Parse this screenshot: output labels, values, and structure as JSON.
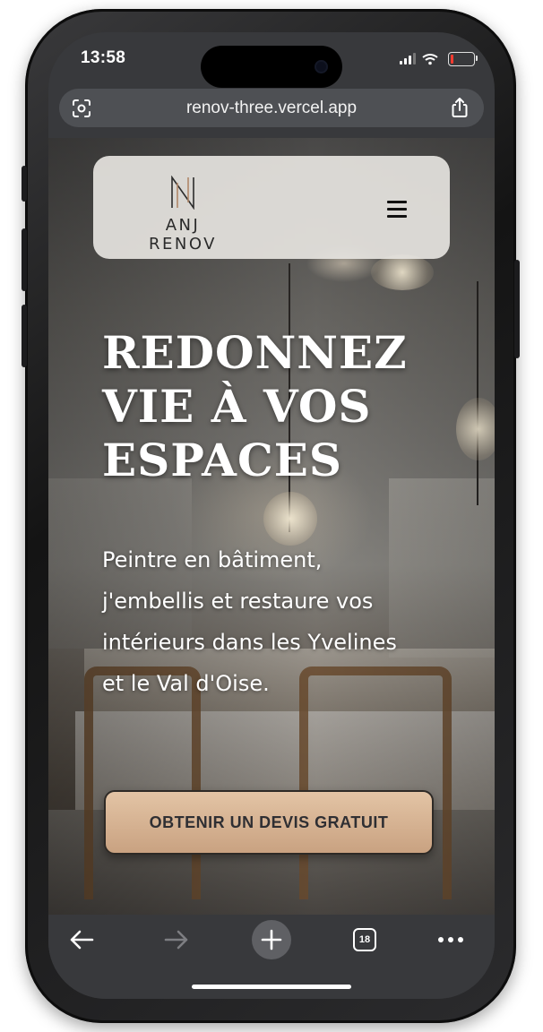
{
  "status_bar": {
    "time": "13:58",
    "battery_level": 0.12,
    "battery_color": "#ff3b30"
  },
  "browser": {
    "url": "renov-three.vercel.app",
    "left_icon": "camera-scan-icon",
    "right_icon": "share-icon",
    "tab_count": "18",
    "toolbar_icons": [
      "back-arrow-icon",
      "forward-arrow-icon",
      "new-tab-plus-icon",
      "tabs-icon",
      "more-icon"
    ]
  },
  "site": {
    "brand": "ANJ RENOV",
    "menu_icon": "hamburger-menu-icon",
    "headline_lines": [
      "REDONNEZ",
      "VIE À VOS",
      "ESPACES"
    ],
    "subtitle_lines": [
      "Peintre en bâtiment,",
      "j'embellis et restaure vos",
      "intérieurs dans les Yvelines",
      "et le Val d'Oise."
    ],
    "cta_label": "OBTENIR UN DEVIS GRATUIT",
    "cta_color": "#d9b594"
  }
}
